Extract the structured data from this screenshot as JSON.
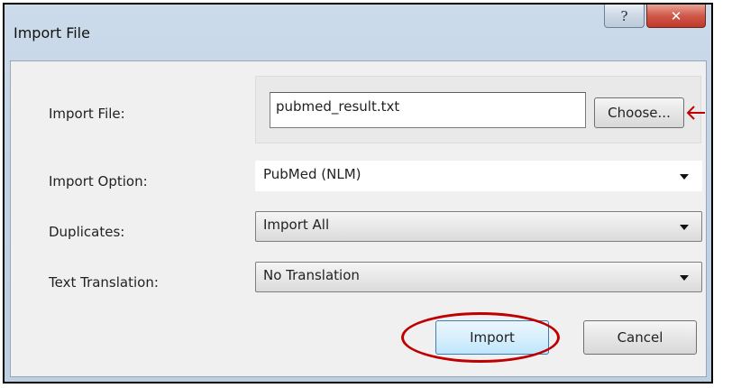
{
  "window": {
    "title": "Import File",
    "help_glyph": "?",
    "close_glyph": "✕"
  },
  "form": {
    "import_file_label": "Import File:",
    "import_file_value": "pubmed_result.txt",
    "choose_label": "Choose...",
    "import_option_label": "Import Option:",
    "import_option_value": "PubMed (NLM)",
    "duplicates_label": "Duplicates:",
    "duplicates_value": "Import All",
    "text_translation_label": "Text Translation:",
    "text_translation_value": "No Translation"
  },
  "buttons": {
    "import_label": "Import",
    "cancel_label": "Cancel"
  },
  "colors": {
    "annotation": "#c00000",
    "titlebar": "#c2d3e6",
    "close": "#c0392b"
  },
  "icons": {
    "help": "help-icon",
    "close": "close-icon",
    "dropdown": "chevron-down-icon",
    "annotation_arrow": "arrow-left-icon"
  }
}
